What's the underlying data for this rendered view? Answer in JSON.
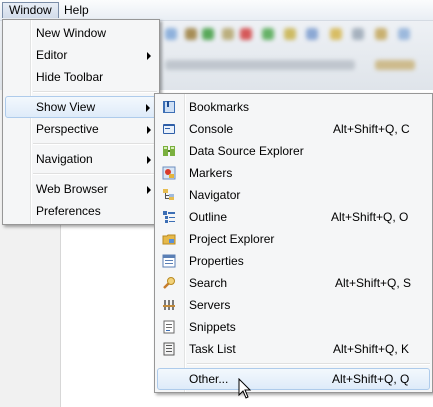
{
  "menubar": {
    "items": [
      {
        "label": "Window"
      },
      {
        "label": "Help"
      }
    ]
  },
  "window_menu": {
    "items": [
      {
        "label": "New Window"
      },
      {
        "label": "Editor"
      },
      {
        "label": "Hide Toolbar"
      },
      {
        "label": "Show View"
      },
      {
        "label": "Perspective"
      },
      {
        "label": "Navigation"
      },
      {
        "label": "Web Browser"
      },
      {
        "label": "Preferences"
      }
    ]
  },
  "show_view_menu": {
    "items": [
      {
        "label": "Bookmarks",
        "shortcut": "",
        "icon": "bookmarks-icon"
      },
      {
        "label": "Console",
        "shortcut": "Alt+Shift+Q, C",
        "icon": "console-icon"
      },
      {
        "label": "Data Source Explorer",
        "shortcut": "",
        "icon": "data-source-explorer-icon"
      },
      {
        "label": "Markers",
        "shortcut": "",
        "icon": "markers-icon"
      },
      {
        "label": "Navigator",
        "shortcut": "",
        "icon": "navigator-icon"
      },
      {
        "label": "Outline",
        "shortcut": "Alt+Shift+Q, O",
        "icon": "outline-icon"
      },
      {
        "label": "Project Explorer",
        "shortcut": "",
        "icon": "project-explorer-icon"
      },
      {
        "label": "Properties",
        "shortcut": "",
        "icon": "properties-icon"
      },
      {
        "label": "Search",
        "shortcut": "Alt+Shift+Q, S",
        "icon": "search-icon"
      },
      {
        "label": "Servers",
        "shortcut": "",
        "icon": "servers-icon"
      },
      {
        "label": "Snippets",
        "shortcut": "",
        "icon": "snippets-icon"
      },
      {
        "label": "Task List",
        "shortcut": "Alt+Shift+Q, K",
        "icon": "task-list-icon"
      },
      {
        "label": "Other...",
        "shortcut": "Alt+Shift+Q, Q",
        "icon": ""
      }
    ]
  },
  "colors": {
    "menu_bg": "#f5f6f7",
    "highlight_bg": "#deebf9",
    "highlight_border": "#aecbeb"
  }
}
